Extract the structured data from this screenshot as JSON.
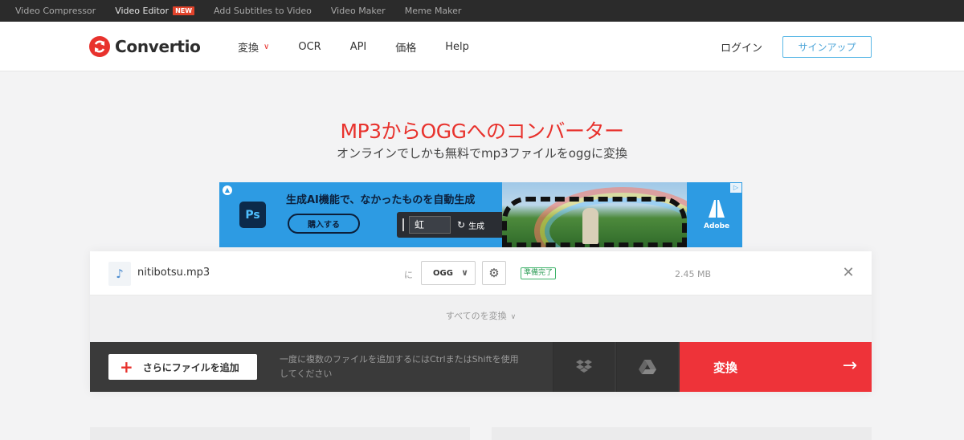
{
  "topbar": {
    "links": [
      {
        "label": "Video Compressor"
      },
      {
        "label": "Video Editor",
        "badge": "NEW"
      },
      {
        "label": "Add Subtitles to Video"
      },
      {
        "label": "Video Maker"
      },
      {
        "label": "Meme Maker"
      }
    ]
  },
  "header": {
    "brand": "Convertio",
    "nav": [
      {
        "label": "変換"
      },
      {
        "label": "OCR"
      },
      {
        "label": "API"
      },
      {
        "label": "価格"
      },
      {
        "label": "Help"
      }
    ],
    "login": "ログイン",
    "signup": "サインアップ"
  },
  "hero": {
    "title": "MP3からOGGへのコンバーター",
    "subtitle": "オンラインでしかも無料でmp3ファイルをoggに変換"
  },
  "ad": {
    "app_icon": "Ps",
    "headline": "生成AI機能で、なかったものを自動生成",
    "cta": "購入する",
    "prompt_value": "虹",
    "generate_label": "生成",
    "brand": "Adobe"
  },
  "converter": {
    "file": {
      "name": "nitibotsu.mp3",
      "to_label": "に",
      "format": "OGG",
      "status": "準備完了",
      "size": "2.45 MB"
    },
    "convert_all": "すべてのを変換",
    "add_files": "さらにファイルを追加",
    "hint_line1": "一度に複数のファイルを追加するにはCtrlまたはShiftを使用",
    "hint_line2": "してください",
    "convert": "変換"
  },
  "colors": {
    "accent": "#e8322d",
    "signup": "#4fa6d9",
    "status": "#2f9e58",
    "convert_button": "#ee3339"
  },
  "icons": [
    "logo-icon",
    "chevron-down-icon",
    "music-note-icon",
    "gear-icon",
    "close-icon",
    "plus-icon",
    "dropbox-icon",
    "google-drive-icon",
    "arrow-right-icon",
    "adobe-icon"
  ]
}
